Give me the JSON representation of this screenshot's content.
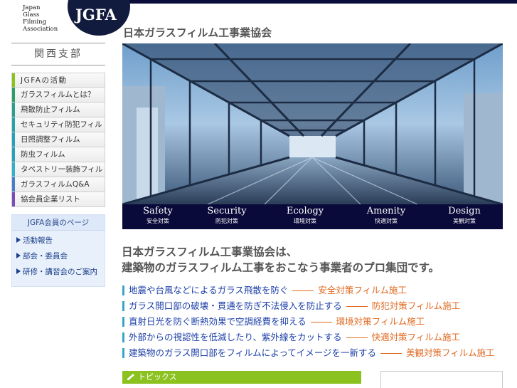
{
  "logo": {
    "lines": [
      "Japan",
      "Glass",
      "Filming",
      "Association"
    ],
    "mark": "JGFA"
  },
  "site_title": "日本ガラスフィルム工事業協会",
  "branch": "関西支部",
  "nav": [
    {
      "label": "JGFAの活動",
      "color": "#8cc21f"
    },
    {
      "label": "ガラスフィルムとは？",
      "color": "#2f9d6b"
    },
    {
      "label": "飛散防止フィルム",
      "color": "#2f9d8e"
    },
    {
      "label": "セキュリティ防犯フィルム",
      "color": "#2aa0a8"
    },
    {
      "label": "日照調整フィルム",
      "color": "#2a9fb8"
    },
    {
      "label": "防虫フィルム",
      "color": "#2a9fb8"
    },
    {
      "label": "タペストリー装飾フィルム",
      "color": "#36b0c6"
    },
    {
      "label": "ガラスフィルムQ&A",
      "color": "#4a7ec8"
    },
    {
      "label": "協会員企業リスト",
      "color": "#7a4cb8"
    }
  ],
  "member": {
    "title": "JGFA会員のページ",
    "links": [
      "活動報告",
      "部会・委員会",
      "研修・講習会のご案内"
    ]
  },
  "hero": {
    "captions": [
      {
        "en": "Safety",
        "ja": "安全対策"
      },
      {
        "en": "Security",
        "ja": "防犯対策"
      },
      {
        "en": "Ecology",
        "ja": "環境対策"
      },
      {
        "en": "Amenity",
        "ja": "快適対策"
      },
      {
        "en": "Design",
        "ja": "美観対策"
      }
    ]
  },
  "headline": {
    "line1": "日本ガラスフィルム工事業協会は、",
    "line2": "建築物のガラスフィルム工事をおこなう事業者のプロ集団です。"
  },
  "features": [
    {
      "text": "地震や台風などによるガラス飛散を防ぐ",
      "dest": "安全対策フィルム施工"
    },
    {
      "text": "ガラス開口部の破壊・貫通を防ぎ不法侵入を防止する",
      "dest": "防犯対策フィルム施工"
    },
    {
      "text": "直射日光を防ぐ断熱効果で空調経費を抑える",
      "dest": "環境対策フィルム施工"
    },
    {
      "text": "外部からの視認性を低減したり、紫外線をカットする",
      "dest": "快適対策フィルム施工"
    },
    {
      "text": "建築物のガラス開口部をフィルムによってイメージを一新する",
      "dest": "美観対策フィルム施工"
    }
  ],
  "topics": "トピックス",
  "colors": {
    "navy": "#0a0d3a",
    "accent_orange": "#e06a22",
    "link_blue": "#1c3fa8",
    "topics_green": "#8cc21f"
  }
}
